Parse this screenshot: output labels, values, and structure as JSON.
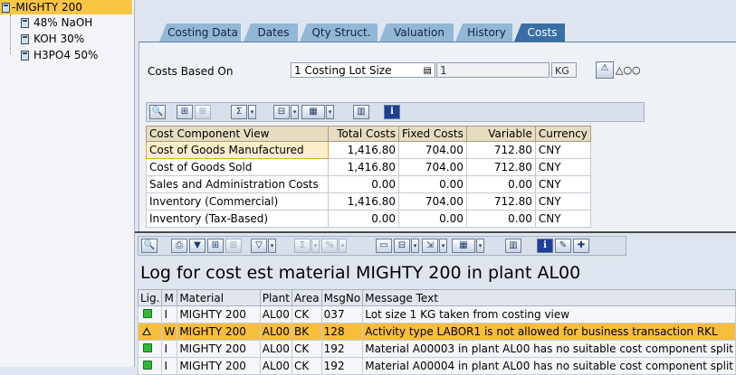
{
  "tree": {
    "root": "MIGHTY 200",
    "children": [
      "48% NaOH",
      "KOH 30%",
      "H3PO4 50%"
    ]
  },
  "tabs": [
    "Costing Data",
    "Dates",
    "Qty Struct.",
    "Valuation",
    "History",
    "Costs"
  ],
  "active_tab": "Costs",
  "costs": {
    "based_on_label": "Costs Based On",
    "lot_size_value": "1 Costing Lot Size",
    "quantity": "1",
    "unit": "KG"
  },
  "component_table": {
    "headers": [
      "Cost Component View",
      "Total Costs",
      "Fixed Costs",
      "Variable",
      "Currency"
    ],
    "rows": [
      [
        "Cost of Goods Manufactured",
        "1,416.80",
        "704.00",
        "712.80",
        "CNY"
      ],
      [
        "Cost of Goods Sold",
        "1,416.80",
        "704.00",
        "712.80",
        "CNY"
      ],
      [
        "Sales and Administration Costs",
        "0.00",
        "0.00",
        "0.00",
        "CNY"
      ],
      [
        "Inventory (Commercial)",
        "1,416.80",
        "704.00",
        "712.80",
        "CNY"
      ],
      [
        "Inventory (Tax-Based)",
        "0.00",
        "0.00",
        "0.00",
        "CNY"
      ]
    ]
  },
  "log": {
    "title": "Log for cost est material MIGHTY 200 in plant AL00",
    "headers": [
      "Lig.",
      "M",
      "Material",
      "Plant",
      "Area",
      "MsgNo",
      "Message Text"
    ],
    "rows": [
      [
        "",
        "I",
        "MIGHTY 200",
        "AL00",
        "CK",
        "037",
        "Lot size 1 KG taken from costing view"
      ],
      [
        "",
        "W",
        "MIGHTY 200",
        "AL00",
        "BK",
        "128",
        "Activity type LABOR1 is not allowed for business transaction RKL"
      ],
      [
        "",
        "I",
        "MIGHTY 200",
        "AL00",
        "CK",
        "192",
        "Material A00003 in plant AL00 has no suitable cost component split"
      ],
      [
        "",
        "I",
        "MIGHTY 200",
        "AL00",
        "CK",
        "192",
        "Material A00004 in plant AL00 has no suitable cost component split"
      ]
    ]
  },
  "icons": {
    "tree": "calculator-icon",
    "toolbar": [
      "zoom-icon",
      "find-icon",
      "find-next-icon",
      "sum-icon",
      "layout-icon",
      "export-icon",
      "graphic-icon",
      "info-icon",
      "print-icon",
      "filter-icon",
      "sort-icon"
    ]
  }
}
